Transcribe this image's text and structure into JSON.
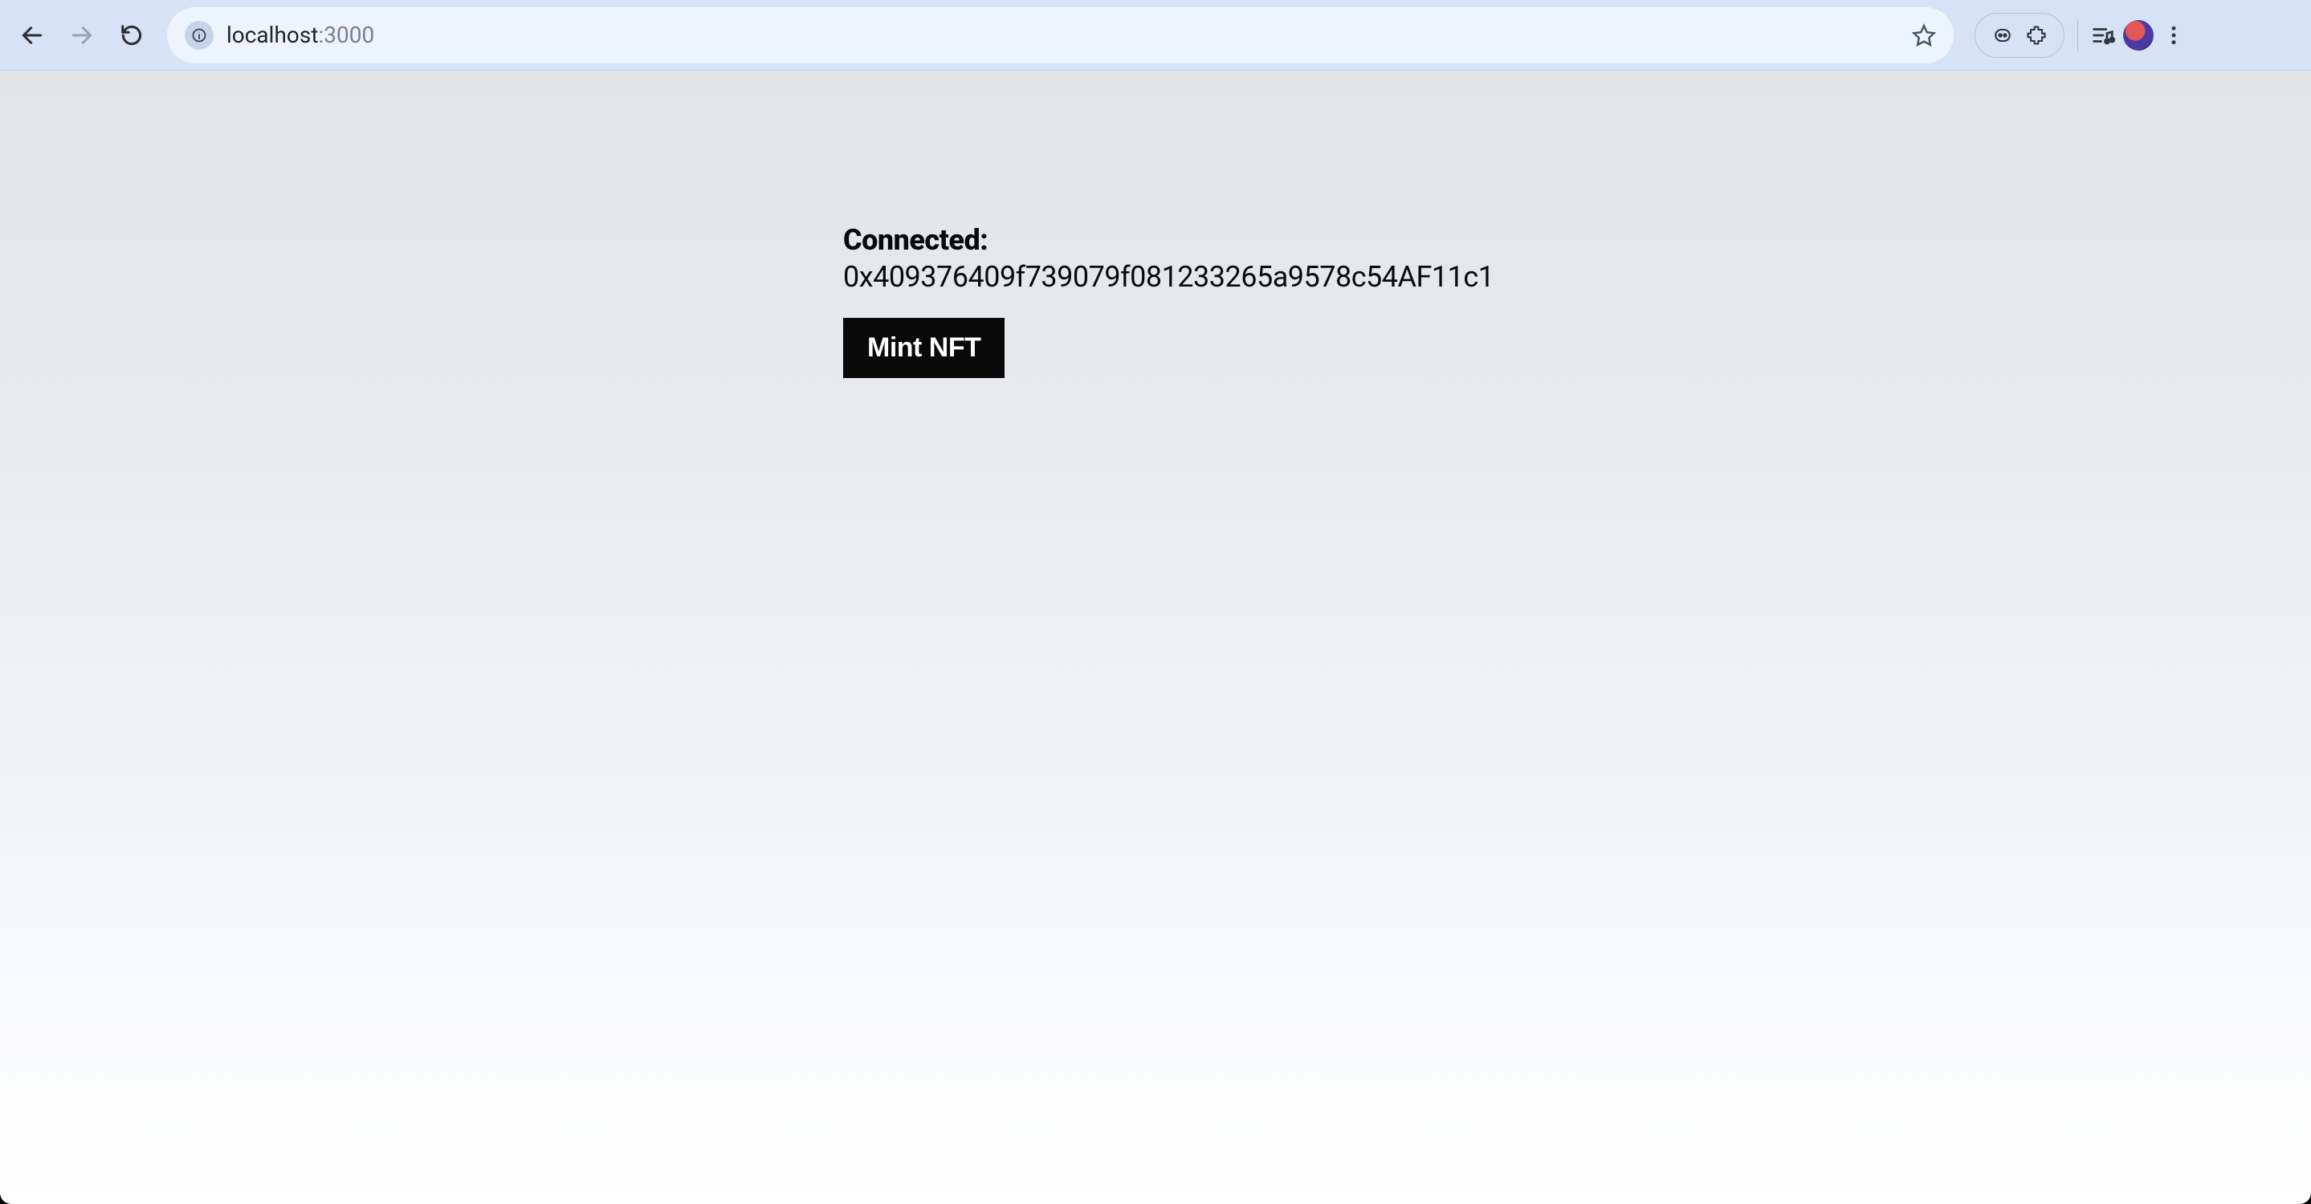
{
  "browser": {
    "url_host": "localhost",
    "url_port": ":3000"
  },
  "main": {
    "connected_label": "Connected:",
    "wallet_address": "0x409376409f739079f081233265a9578c54AF11c1",
    "mint_label": "Mint NFT"
  }
}
